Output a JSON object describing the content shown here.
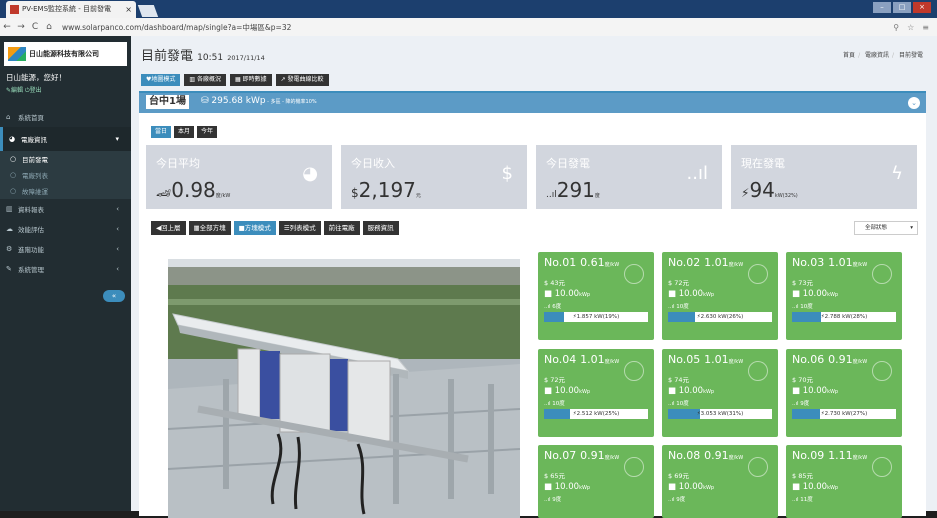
{
  "browser": {
    "tab_title": "PV-EMS監控系統 - 目前發電",
    "tab_close": "×",
    "url": "www.solarpanco.com/dashboard/map/single?a=中場區&p=32",
    "nav_back": "←",
    "nav_forward": "→",
    "nav_reload": "C",
    "nav_home": "⌂",
    "icons": [
      "search-icon",
      "star-icon",
      "menu-icon"
    ]
  },
  "sidebar": {
    "logo_text": "日山能源科技有限公司",
    "user_greeting": "日山能源，您好！",
    "user_links": "✎編輯 ⏻登出",
    "items": [
      {
        "label": "系統首頁",
        "icon": "home-icon",
        "chevron": ""
      },
      {
        "label": "電廠資訊",
        "icon": "dashboard-icon",
        "chevron": "▾"
      },
      {
        "label": "資料報表",
        "icon": "chart-icon",
        "chevron": "‹"
      },
      {
        "label": "效能評估",
        "icon": "cloud-icon",
        "chevron": "‹"
      },
      {
        "label": "進階功能",
        "icon": "gear-icon",
        "chevron": "‹"
      },
      {
        "label": "系統管理",
        "icon": "wrench-icon",
        "chevron": "‹"
      }
    ],
    "subitems": [
      {
        "label": "目前發電"
      },
      {
        "label": "電廠列表"
      },
      {
        "label": "故障維運"
      }
    ],
    "collapse_label": "«"
  },
  "header": {
    "title": "目前發電",
    "time": "10:51",
    "date": "2017/11/14",
    "breadcrumb": [
      "首頁",
      "電廠資訊",
      "目前發電"
    ],
    "modes": [
      "地圖模式",
      "各廠概況",
      "即時數據",
      "發電曲線比較"
    ]
  },
  "site": {
    "name": "台中1場",
    "capacity": "295.68 kWp",
    "capacity_note": " - 多區 - 降的機率10%",
    "periods": [
      "當日",
      "本月",
      "今年"
    ]
  },
  "kpis": [
    {
      "title": "今日平均",
      "prefix": "🏎",
      "value": "0.98",
      "unit": "度/kW",
      "icon": "speedometer-icon",
      "glyph": "◕"
    },
    {
      "title": "今日收入",
      "prefix": "$",
      "value": "2,197",
      "unit": "元",
      "icon": "dollar-icon",
      "glyph": "$"
    },
    {
      "title": "今日發電",
      "prefix": "..ıl",
      "value": "291",
      "unit": "度",
      "icon": "signal-bars-icon",
      "glyph": "..ıl"
    },
    {
      "title": "現在發電",
      "prefix": "⚡",
      "value": "94",
      "unit": "kW(32%)",
      "icon": "lightning-icon",
      "glyph": "ϟ"
    }
  ],
  "toolbar": {
    "buttons": [
      "◀回上層",
      "▦全部方塊",
      "■方塊模式",
      "☰列表模式",
      "前往電廠",
      "服務資訊"
    ],
    "filter": "全部狀態",
    "filter_arrow": "▾"
  },
  "inverters": [
    {
      "no": "No.01",
      "ratio": "0.61",
      "unit": "度/kW",
      "income": "$ 43元",
      "capacity": "■ 10.00",
      "cap_unit": "kWp",
      "energy": "..ıl 6度",
      "power": "⚡1.857 kW(19%)",
      "pct": 19
    },
    {
      "no": "No.02",
      "ratio": "1.01",
      "unit": "度/kW",
      "income": "$ 72元",
      "capacity": "■ 10.00",
      "cap_unit": "kWp",
      "energy": "..ıl 10度",
      "power": "⚡2.630 kW(26%)",
      "pct": 26
    },
    {
      "no": "No.03",
      "ratio": "1.01",
      "unit": "度/kW",
      "income": "$ 73元",
      "capacity": "■ 10.00",
      "cap_unit": "kWp",
      "energy": "..ıl 10度",
      "power": "⚡2.788 kW(28%)",
      "pct": 28
    },
    {
      "no": "No.04",
      "ratio": "1.01",
      "unit": "度/kW",
      "income": "$ 72元",
      "capacity": "■ 10.00",
      "cap_unit": "kWp",
      "energy": "..ıl 10度",
      "power": "⚡2.512 kW(25%)",
      "pct": 25
    },
    {
      "no": "No.05",
      "ratio": "1.01",
      "unit": "度/kW",
      "income": "$ 74元",
      "capacity": "■ 10.00",
      "cap_unit": "kWp",
      "energy": "..ıl 10度",
      "power": "⚡3.053 kW(31%)",
      "pct": 31
    },
    {
      "no": "No.06",
      "ratio": "0.91",
      "unit": "度/kW",
      "income": "$ 70元",
      "capacity": "■ 10.00",
      "cap_unit": "kWp",
      "energy": "..ıl 9度",
      "power": "⚡2.730 kW(27%)",
      "pct": 27
    },
    {
      "no": "No.07",
      "ratio": "0.91",
      "unit": "度/kW",
      "income": "$ 65元",
      "capacity": "■ 10.00",
      "cap_unit": "kWp",
      "energy": "..ıl 9度",
      "power": "",
      "pct": 0
    },
    {
      "no": "No.08",
      "ratio": "0.91",
      "unit": "度/kW",
      "income": "$ 69元",
      "capacity": "■ 10.00",
      "cap_unit": "kWp",
      "energy": "..ıl 9度",
      "power": "",
      "pct": 0
    },
    {
      "no": "No.09",
      "ratio": "1.11",
      "unit": "度/kW",
      "income": "$ 85元",
      "capacity": "■ 10.00",
      "cap_unit": "kWp",
      "energy": "..ıl 11度",
      "power": "",
      "pct": 0
    }
  ],
  "colors": {
    "accent": "#3c8dbc",
    "card": "#6bb75a",
    "sidebar": "#222d32",
    "kpi": "#d2d6de"
  }
}
